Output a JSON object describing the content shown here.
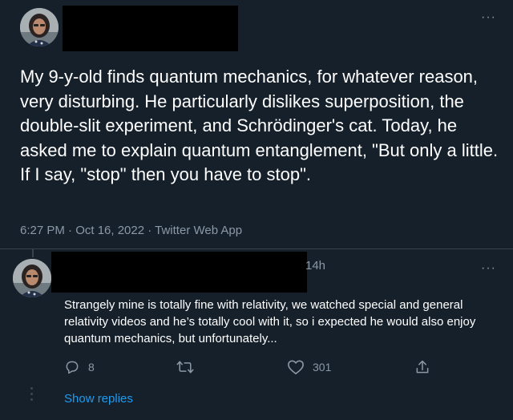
{
  "main_tweet": {
    "text": "My 9-y-old finds quantum mechanics, for whatever reason, very disturbing. He particularly dislikes superposition, the double-slit experiment, and Schrödinger's cat. Today, he asked me to explain quantum entanglement, \"But only a little. If I say, \"stop\" then you have to stop\".",
    "timestamp": "6:27 PM · Oct 16, 2022 · Twitter Web App",
    "more_icon": "···"
  },
  "reply": {
    "time": "14h",
    "more_icon": "···",
    "text": "Strangely mine is totally fine with relativity, we watched special and general relativity videos and he’s totally cool with it, so i expected he would also enjoy quantum mechanics, but unfortunately...",
    "actions": {
      "reply_count": "8",
      "retweet_count": "",
      "like_count": "301"
    },
    "show_replies": "Show replies"
  },
  "icons": {
    "reply": "reply-icon",
    "retweet": "retweet-icon",
    "like": "heart-icon",
    "share": "share-icon"
  },
  "colors": {
    "background": "#15202b",
    "muted_text": "#8b98a5",
    "link": "#1d9bf0",
    "divider": "#38444d"
  }
}
